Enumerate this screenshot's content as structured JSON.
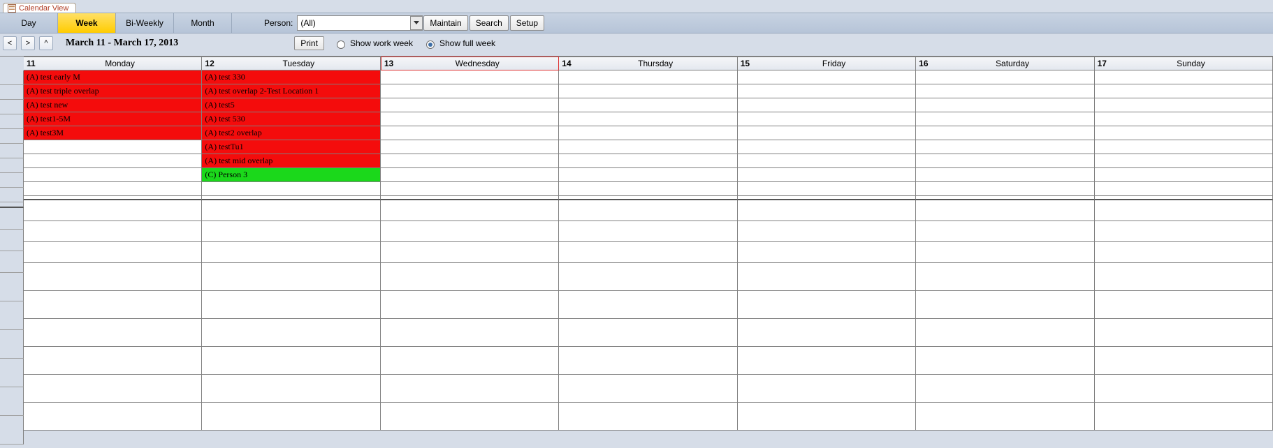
{
  "tab": {
    "title": "Calendar View"
  },
  "toolbar": {
    "views": [
      {
        "label": "Day",
        "active": false
      },
      {
        "label": "Week",
        "active": true
      },
      {
        "label": "Bi-Weekly",
        "active": false
      },
      {
        "label": "Month",
        "active": false
      }
    ],
    "person_label": "Person:",
    "person_value": "(All)",
    "buttons": {
      "maintain": "Maintain",
      "search": "Search",
      "setup": "Setup"
    }
  },
  "subbar": {
    "nav": {
      "prev": "<",
      "next": ">",
      "up": "^"
    },
    "date_range": "March 11 - March 17, 2013",
    "print": "Print",
    "radios": {
      "work_week": "Show work week",
      "full_week": "Show full week"
    }
  },
  "days": [
    {
      "num": "11",
      "name": "Monday"
    },
    {
      "num": "12",
      "name": "Tuesday"
    },
    {
      "num": "13",
      "name": "Wednesday"
    },
    {
      "num": "14",
      "name": "Thursday"
    },
    {
      "num": "15",
      "name": "Friday"
    },
    {
      "num": "16",
      "name": "Saturday"
    },
    {
      "num": "17",
      "name": "Sunday"
    }
  ],
  "events": {
    "monday": [
      {
        "text": "(A) test early M",
        "color": "red"
      },
      {
        "text": "(A) test triple overlap",
        "color": "red"
      },
      {
        "text": "(A) test new",
        "color": "red"
      },
      {
        "text": "(A) test1-5M",
        "color": "red"
      },
      {
        "text": "(A) test3M",
        "color": "red"
      }
    ],
    "tuesday": [
      {
        "text": "(A) test 330",
        "color": "red"
      },
      {
        "text": "(A) test overlap 2-Test Location 1",
        "color": "red"
      },
      {
        "text": "(A) test5",
        "color": "red"
      },
      {
        "text": "(A) test 530",
        "color": "red"
      },
      {
        "text": "(A) test2 overlap",
        "color": "red"
      },
      {
        "text": "(A) testTu1",
        "color": "red"
      },
      {
        "text": "(A) test mid overlap",
        "color": "red"
      },
      {
        "text": "(C) Person 3",
        "color": "green"
      }
    ]
  },
  "grid": {
    "event_rows": 9,
    "blank_rows": 9
  }
}
